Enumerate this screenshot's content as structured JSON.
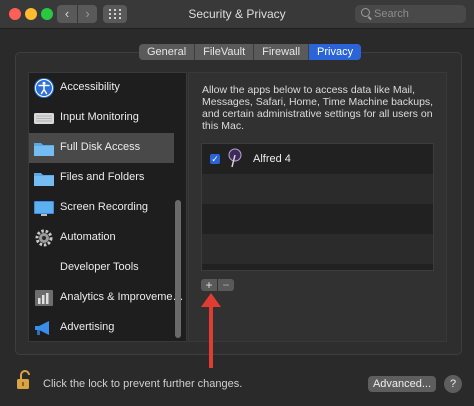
{
  "window": {
    "title": "Security & Privacy",
    "search_placeholder": "Search",
    "back_glyph": "‹",
    "forward_glyph": "›"
  },
  "tabs": [
    {
      "label": "General",
      "active": false
    },
    {
      "label": "FileVault",
      "active": false
    },
    {
      "label": "Firewall",
      "active": false
    },
    {
      "label": "Privacy",
      "active": true
    }
  ],
  "sidebar": {
    "items": [
      {
        "label": "Accessibility",
        "icon": "accessibility-icon"
      },
      {
        "label": "Input Monitoring",
        "icon": "keyboard-icon"
      },
      {
        "label": "Full Disk Access",
        "icon": "folder-icon",
        "selected": true
      },
      {
        "label": "Files and Folders",
        "icon": "folder-icon"
      },
      {
        "label": "Screen Recording",
        "icon": "display-icon"
      },
      {
        "label": "Automation",
        "icon": "gear-icon"
      },
      {
        "label": "Developer Tools",
        "icon": ""
      },
      {
        "label": "Analytics & Improveme…",
        "icon": "chart-icon"
      },
      {
        "label": "Advertising",
        "icon": "megaphone-icon"
      }
    ]
  },
  "main": {
    "description": "Allow the apps below to access data like Mail, Messages, Safari, Home, Time Machine backups, and certain administrative settings for all users on this Mac.",
    "apps": [
      {
        "name": "Alfred 4",
        "checked": true,
        "icon": "alfred-hat-icon"
      }
    ],
    "add_label": "+",
    "remove_label": "−"
  },
  "footer": {
    "lock_text": "Click the lock to prevent further changes.",
    "advanced_label": "Advanced...",
    "help_label": "?"
  },
  "colors": {
    "accent": "#2a64d6",
    "annotation_arrow": "#e03c31"
  }
}
